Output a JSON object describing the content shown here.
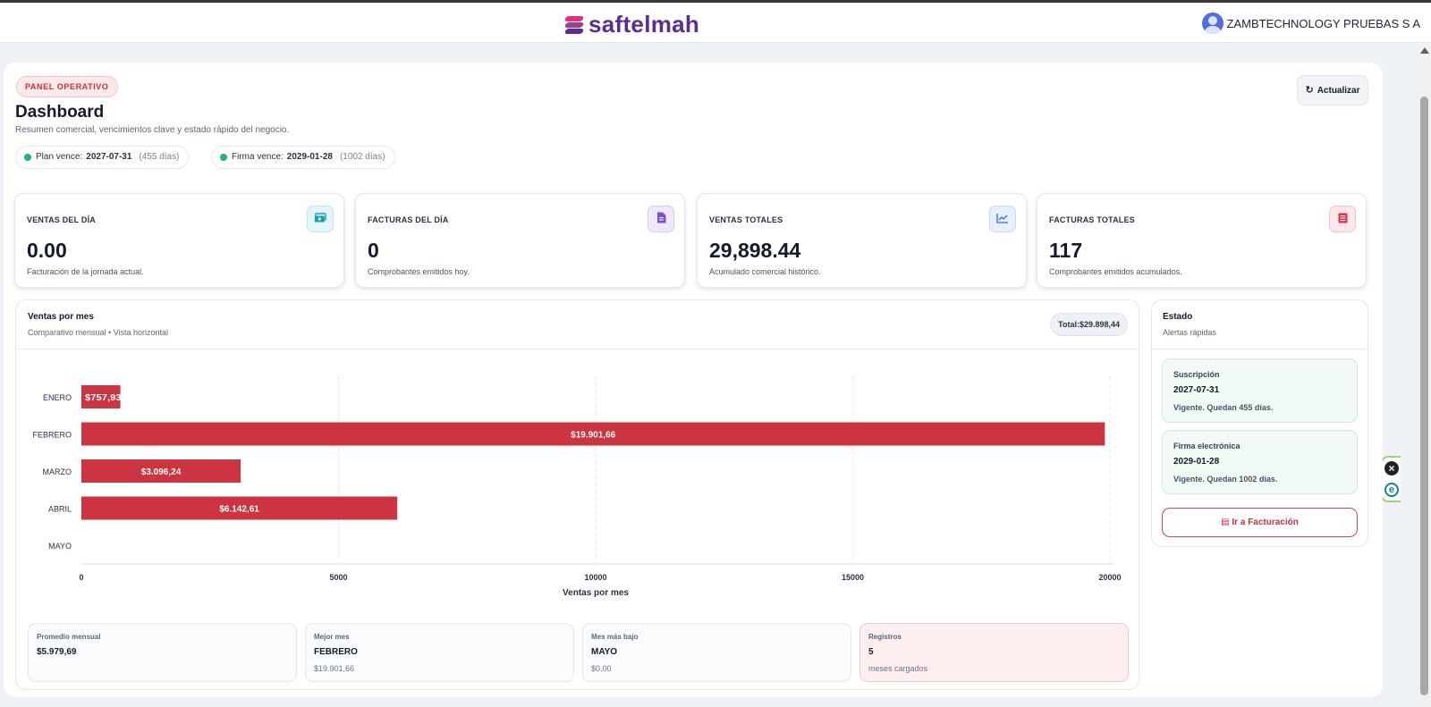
{
  "app": {
    "brand": "saftelmah",
    "user": "ZAMBTECHNOLOGY PRUEBAS S A",
    "colors": {
      "brand_purple": "#5b2d8e",
      "brand_pink": "#e0327a",
      "accent_red": "#c8303f",
      "bar_red": "#cc3441",
      "ok_green": "#22b573"
    }
  },
  "header": {
    "badge": "PANEL OPERATIVO",
    "title": "Dashboard",
    "subtitle": "Resumen comercial, vencimientos clave y estado rápido del negocio.",
    "refresh_label": "Actualizar",
    "chips": [
      {
        "label": "Plan vence:",
        "date": "2027-07-31",
        "days": "(455 días)"
      },
      {
        "label": "Firma vence:",
        "date": "2029-01-28",
        "days": "(1002 días)"
      }
    ]
  },
  "kpis": [
    {
      "label": "VENTAS DEL DÍA",
      "value": "0.00",
      "desc": "Facturación de la jornada actual.",
      "icon": "money-icon",
      "color": "#1a9fb0",
      "bg": "#e3f5f7"
    },
    {
      "label": "FACTURAS DEL DÍA",
      "value": "0",
      "desc": "Comprobantes emitidos hoy.",
      "icon": "document-icon",
      "color": "#7b4fd3",
      "bg": "#efe8fb"
    },
    {
      "label": "VENTAS TOTALES",
      "value": "29,898.44",
      "desc": "Acumulado comercial histórico.",
      "icon": "line-chart-icon",
      "color": "#2f6fcf",
      "bg": "#e6effb"
    },
    {
      "label": "FACTURAS TOTALES",
      "value": "117",
      "desc": "Comprobantes emitidos acumulados.",
      "icon": "list-icon",
      "color": "#d83248",
      "bg": "#fde7ea"
    }
  ],
  "sales_card": {
    "title": "Ventas por mes",
    "subtitle": "Comparativo mensual • Vista horizontal",
    "total": "Total:$29.898,44"
  },
  "chart_data": {
    "type": "bar",
    "orientation": "horizontal",
    "categories": [
      "ENERO",
      "FEBRERO",
      "MARZO",
      "ABRIL",
      "MAYO"
    ],
    "values": [
      757.93,
      19901.66,
      3096.24,
      6142.61,
      0
    ],
    "data_labels": [
      "$757,93",
      "$19.901,66",
      "$3.096,24",
      "$6.142,61",
      ""
    ],
    "xlabel": "Ventas por mes",
    "xlim": [
      0,
      20000
    ],
    "xticks": [
      0,
      5000,
      10000,
      15000,
      20000
    ],
    "grid": true,
    "bar_color": "#cc3441"
  },
  "stats": [
    {
      "label": "Promedio mensual",
      "value": "$5.979,69",
      "sub": ""
    },
    {
      "label": "Mejor mes",
      "value": "FEBRERO",
      "sub": "$19.901,66"
    },
    {
      "label": "Mes más bajo",
      "value": "MAYO",
      "sub": "$0,00"
    },
    {
      "label": "Registros",
      "value": "5",
      "sub": "meses cargados"
    }
  ],
  "estado": {
    "title": "Estado",
    "subtitle": "Alertas rápidas",
    "alerts": [
      {
        "label": "Suscripción",
        "date": "2027-07-31",
        "desc": "Vigente. Quedan 455 días."
      },
      {
        "label": "Firma electrónica",
        "date": "2029-01-28",
        "desc": "Vigente. Quedan 1002 días."
      }
    ],
    "button": "Ir a Facturación"
  }
}
